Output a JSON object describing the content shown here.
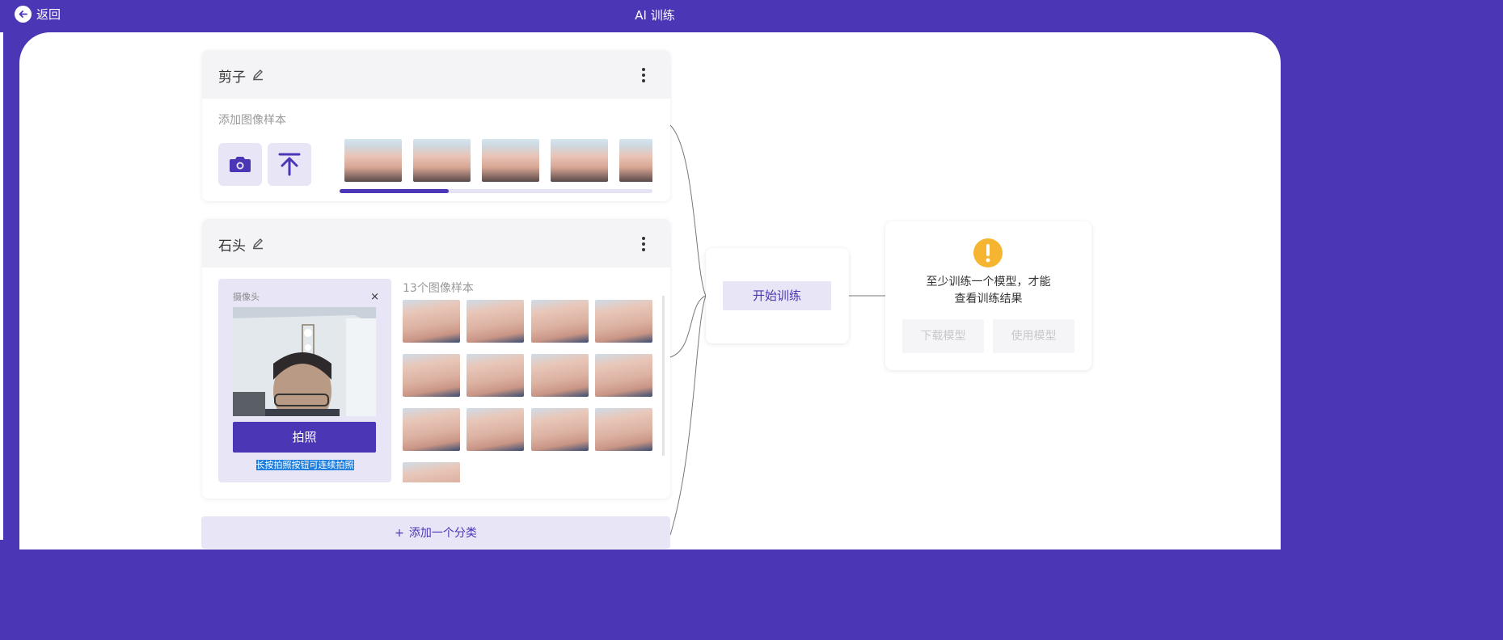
{
  "header": {
    "back_label": "返回",
    "title": "AI 训练"
  },
  "classes": [
    {
      "name": "剪子",
      "add_samples_label": "添加图像样本",
      "visible_sample_count": 5,
      "scroll_progress": 0.35
    },
    {
      "name": "石头",
      "samples_label": "13个图像样本",
      "sample_count": 13,
      "camera": {
        "title": "摄像头",
        "close_glyph": "×",
        "shoot_label": "拍照",
        "hint": "长按拍照按钮可连续拍照"
      }
    }
  ],
  "add_class_label": "添加一个分类",
  "add_class_icon": "+",
  "train": {
    "button_label": "开始训练"
  },
  "result": {
    "warning_line1": "至少训练一个模型，才能",
    "warning_line2": "查看训练结果",
    "download_label": "下载模型",
    "use_label": "使用模型"
  },
  "colors": {
    "brand": "#4b36b6",
    "accent_light": "#e8e5f6",
    "warning": "#f6b530"
  }
}
